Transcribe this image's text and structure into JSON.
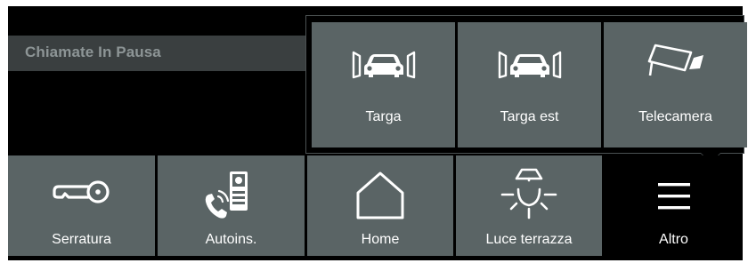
{
  "status": {
    "text": "Chiamate In Pausa"
  },
  "popup": {
    "items": [
      {
        "label": "Targa",
        "icon": "gate-car-icon"
      },
      {
        "label": "Targa est",
        "icon": "gate-car-icon"
      },
      {
        "label": "Telecamera",
        "icon": "camera-icon"
      }
    ]
  },
  "nav": {
    "items": [
      {
        "label": "Serratura",
        "icon": "key-icon"
      },
      {
        "label": "Autoins.",
        "icon": "intercom-call-icon"
      },
      {
        "label": "Home",
        "icon": "home-icon"
      },
      {
        "label": "Luce terrazza",
        "icon": "light-icon"
      },
      {
        "label": "Altro",
        "icon": "menu-icon",
        "active": true
      }
    ]
  },
  "colors": {
    "tile": "#5a6465",
    "background": "#000000",
    "status_bar": "#3a3f40",
    "status_text": "#8d9596"
  }
}
